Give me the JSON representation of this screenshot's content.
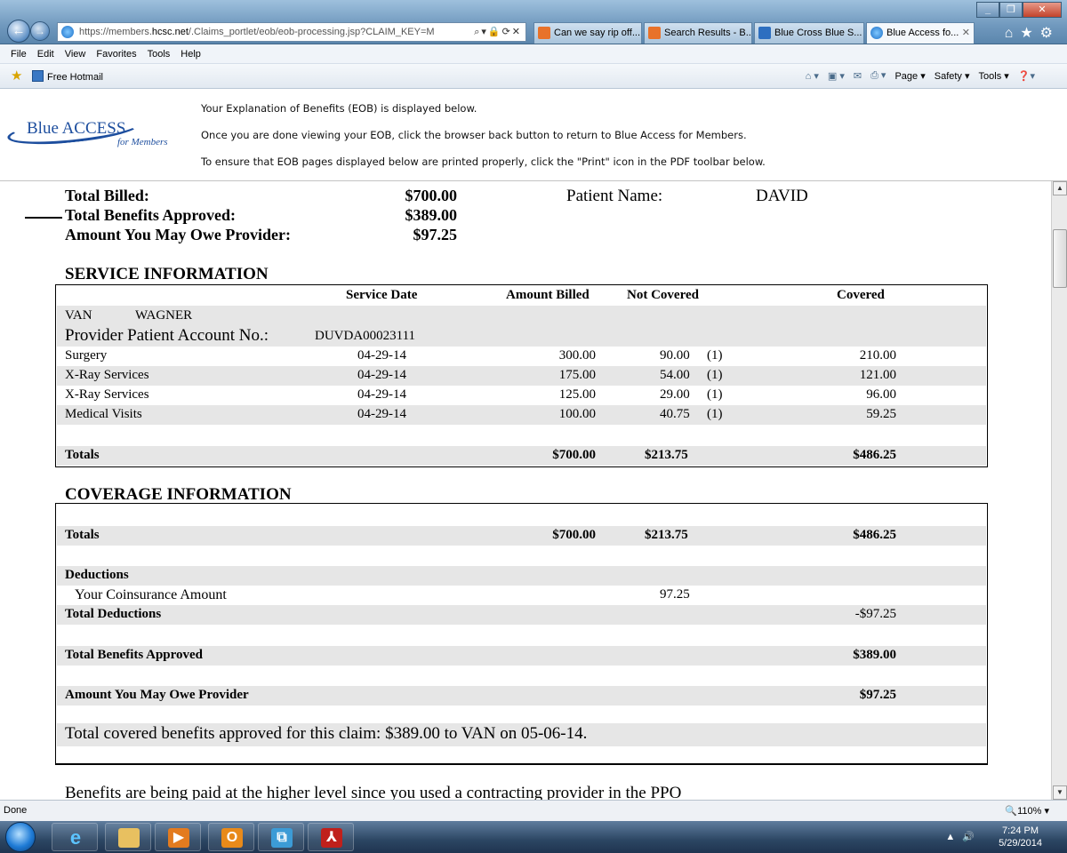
{
  "browser": {
    "url_prefix": "https://members.",
    "url_domain": "hcsc.net",
    "url_rest": "/.Claims_portlet/eob/eob-processing.jsp?CLAIM_KEY=M",
    "tabs": [
      {
        "label": "Can we say rip off..."
      },
      {
        "label": "Search Results - B..."
      },
      {
        "label": "Blue Cross Blue S..."
      },
      {
        "label": "Blue Access fo..."
      }
    ],
    "menu": [
      "File",
      "Edit",
      "View",
      "Favorites",
      "Tools",
      "Help"
    ],
    "favorites": {
      "hotmail": "Free Hotmail"
    },
    "commands": {
      "page": "Page ▾",
      "safety": "Safety ▾",
      "tools": "Tools ▾"
    },
    "status": "Done",
    "zoom": "110%"
  },
  "header": {
    "brand": "Blue ACCESS",
    "sub": "for Members",
    "msg1": "Your Explanation of Benefits (EOB) is displayed below.",
    "msg2": "Once you are done viewing your EOB, click the browser back button to return to Blue Access for Members.",
    "msg3": "To ensure that EOB pages displayed below are printed properly, click the \"Print\" icon in the PDF toolbar below."
  },
  "summary": {
    "billed_label": "Total Billed:",
    "billed": "$700.00",
    "approved_label": "Total Benefits Approved:",
    "approved": "$389.00",
    "owe_label": "Amount You May Owe Provider:",
    "owe": "$97.25",
    "patient_label": "Patient Name:",
    "patient_value": "DAVID"
  },
  "service": {
    "title": "SERVICE INFORMATION",
    "headers": {
      "date": "Service Date",
      "billed": "Amount Billed",
      "not_covered": "Not Covered",
      "covered": "Covered"
    },
    "provider_first": "VAN",
    "provider_last": "WAGNER",
    "account_label": "Provider Patient Account No.:",
    "account_value": "DUVDA00023111",
    "rows": [
      {
        "service": "Surgery",
        "date": "04-29-14",
        "billed": "300.00",
        "not_covered": "90.00",
        "note": "(1)",
        "covered": "210.00"
      },
      {
        "service": "X-Ray Services",
        "date": "04-29-14",
        "billed": "175.00",
        "not_covered": "54.00",
        "note": "(1)",
        "covered": "121.00"
      },
      {
        "service": "X-Ray Services",
        "date": "04-29-14",
        "billed": "125.00",
        "not_covered": "29.00",
        "note": "(1)",
        "covered": "96.00"
      },
      {
        "service": "Medical Visits",
        "date": "04-29-14",
        "billed": "100.00",
        "not_covered": "40.75",
        "note": "(1)",
        "covered": "59.25"
      }
    ],
    "totals": {
      "label": "Totals",
      "billed": "$700.00",
      "not_covered": "$213.75",
      "covered": "$486.25"
    }
  },
  "coverage": {
    "title": "COVERAGE INFORMATION",
    "totals": {
      "label": "Totals",
      "billed": "$700.00",
      "not_covered": "$213.75",
      "covered": "$486.25"
    },
    "deductions_label": "Deductions",
    "coinsurance_label": "Your Coinsurance Amount",
    "coinsurance_value": "97.25",
    "total_deductions_label": "Total Deductions",
    "total_deductions_value": "-$97.25",
    "benefits_label": "Total Benefits Approved",
    "benefits_value": "$389.00",
    "owe_label": "Amount You May Owe Provider",
    "owe_value": "$97.25",
    "claim_text": "Total covered benefits approved for this claim: $389.00 to VAN on 05-06-14."
  },
  "footer_text": "Benefits are being paid at the higher level since you used a contracting provider in the PPO",
  "clock": {
    "time": "7:24 PM",
    "date": "5/29/2014"
  }
}
